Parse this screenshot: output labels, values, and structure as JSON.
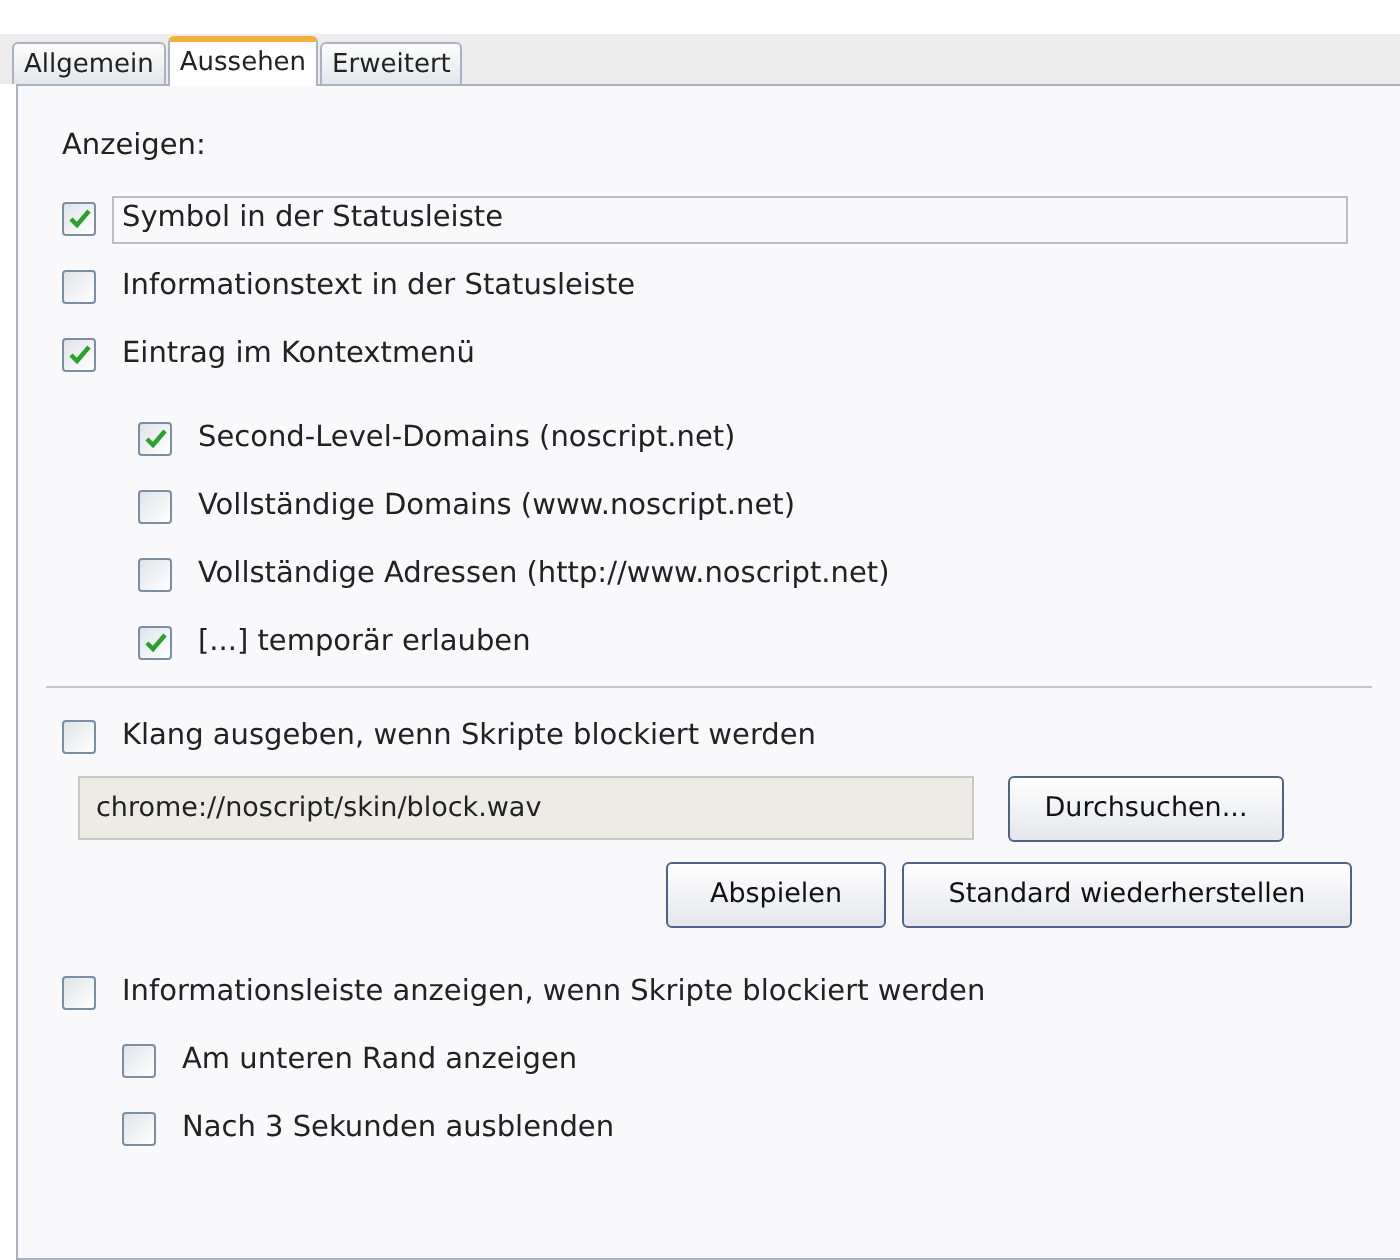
{
  "tabs": [
    {
      "label": "Allgemein",
      "selected": false
    },
    {
      "label": "Aussehen",
      "selected": true
    },
    {
      "label": "Erweitert",
      "selected": false
    }
  ],
  "section_label": "Anzeigen:",
  "display_options": [
    {
      "label": "Symbol in der Statusleiste",
      "checked": true,
      "focused": true
    },
    {
      "label": "Informationstext in der Statusleiste",
      "checked": false,
      "focused": false
    },
    {
      "label": "Eintrag im Kontextmenü",
      "checked": true,
      "focused": false,
      "children": [
        {
          "label": "Second-Level-Domains (noscript.net)",
          "checked": true,
          "focused": false
        },
        {
          "label": "Vollständige Domains (www.noscript.net)",
          "checked": false,
          "focused": false
        },
        {
          "label": "Vollständige Adressen (http://www.noscript.net)",
          "checked": false,
          "focused": false
        },
        {
          "label": "[...] temporär erlauben",
          "checked": true,
          "focused": false
        }
      ]
    }
  ],
  "sound": {
    "label": "Klang ausgeben, wenn Skripte blockiert werden",
    "checked": false,
    "file": "chrome://noscript/skin/block.wav",
    "browse_button": "Durchsuchen...",
    "play_button": "Abspielen",
    "default_button": "Standard wiederherstellen"
  },
  "infobar": {
    "label": "Informationsleiste anzeigen, wenn Skripte blockiert werden",
    "checked": false,
    "children": [
      {
        "label": "Am unteren Rand anzeigen",
        "checked": false,
        "focused": false
      },
      {
        "label": "Nach 3 Sekunden ausblenden",
        "checked": false,
        "focused": false
      }
    ]
  }
}
